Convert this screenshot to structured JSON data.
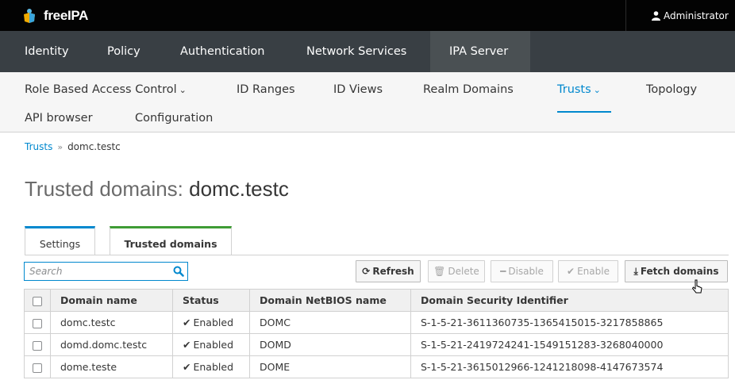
{
  "header": {
    "brand": "freeIPA",
    "user": "Administrator"
  },
  "main_nav": [
    {
      "label": "Identity"
    },
    {
      "label": "Policy"
    },
    {
      "label": "Authentication"
    },
    {
      "label": "Network Services"
    },
    {
      "label": "IPA Server",
      "active": true
    }
  ],
  "sub_nav": [
    {
      "label": "Role Based Access Control",
      "dropdown": true
    },
    {
      "label": "ID Ranges"
    },
    {
      "label": "ID Views"
    },
    {
      "label": "Realm Domains"
    },
    {
      "label": "Trusts",
      "dropdown": true,
      "active": true
    },
    {
      "label": "Topology"
    },
    {
      "label": "API browser"
    },
    {
      "label": "Configuration"
    }
  ],
  "breadcrumb": {
    "parent": "Trusts",
    "separator": "»",
    "current": "domc.testc"
  },
  "title": {
    "prefix": "Trusted domains:",
    "entity": "domc.testc"
  },
  "facets": {
    "settings": "Settings",
    "trusted_domains": "Trusted domains"
  },
  "search": {
    "placeholder": "Search",
    "value": ""
  },
  "toolbar": {
    "refresh": "Refresh",
    "delete": "Delete",
    "disable": "Disable",
    "enable": "Enable",
    "fetch": "Fetch domains"
  },
  "table": {
    "columns": [
      "Domain name",
      "Status",
      "Domain NetBIOS name",
      "Domain Security Identifier"
    ],
    "rows": [
      {
        "name": "domc.testc",
        "status": "Enabled",
        "netbios": "DOMC",
        "sid": "S-1-5-21-3611360735-1365415015-3217858865"
      },
      {
        "name": "domd.domc.testc",
        "status": "Enabled",
        "netbios": "DOMD",
        "sid": "S-1-5-21-2419724241-1549151283-3268040000"
      },
      {
        "name": "dome.teste",
        "status": "Enabled",
        "netbios": "DOME",
        "sid": "S-1-5-21-3615012966-1241218098-4147673574"
      }
    ]
  },
  "colors": {
    "accent": "#0088ce",
    "active_tab": "#3f9c35",
    "nav_bg": "#393f44",
    "header_bg": "#030303"
  },
  "icons": {
    "brand": "freeipa-logo-icon",
    "user": "user-icon",
    "search": "search-icon",
    "refresh": "refresh-icon",
    "delete": "trash-icon",
    "disable": "minus-icon",
    "enable": "check-icon",
    "fetch": "download-icon"
  }
}
